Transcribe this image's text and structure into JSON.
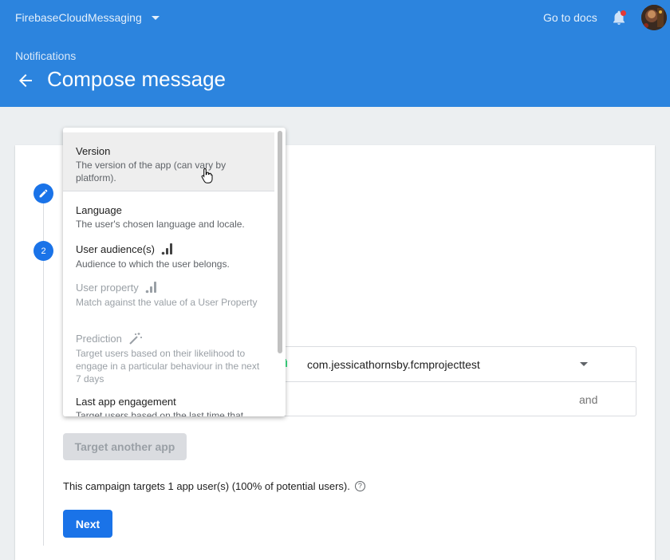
{
  "header": {
    "project": "FirebaseCloudMessaging",
    "docs_link": "Go to docs",
    "breadcrumb": "Notifications",
    "title": "Compose message"
  },
  "steps": {
    "step2_number": "2"
  },
  "dropdown": {
    "items": [
      {
        "title": "Version",
        "description": "The version of the app (can vary by platform)."
      },
      {
        "title": "Language",
        "description": "The user's chosen language and locale."
      },
      {
        "title": "User audience(s)",
        "description": "Audience to which the user belongs."
      },
      {
        "title": "User property",
        "description": "Match against the value of a User Property"
      },
      {
        "title": "Prediction",
        "description": "Target users based on their likelihood to engage in a particular behaviour in the next 7 days"
      },
      {
        "title": "Last app engagement",
        "description": "Target users based on the last time that"
      }
    ]
  },
  "target": {
    "app_id": "com.jessicathornsby.fcmprojecttest",
    "and_label": "and",
    "target_another_label": "Target another app",
    "summary": "This campaign targets 1 app user(s) (100% of potential users).",
    "next_label": "Next"
  },
  "colors": {
    "brand": "#2c84de",
    "accent": "#1a73e8",
    "notification_dot": "#e53935"
  }
}
